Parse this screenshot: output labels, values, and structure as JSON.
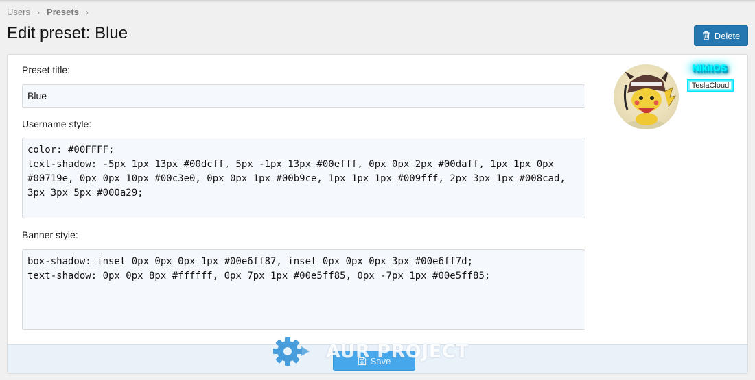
{
  "breadcrumb": {
    "items": [
      "Users",
      "Presets"
    ],
    "separator": "›"
  },
  "page": {
    "title": "Edit preset: Blue"
  },
  "actions": {
    "delete_label": "Delete",
    "save_label": "Save"
  },
  "form": {
    "preset_title_label": "Preset title:",
    "preset_title_value": "Blue",
    "username_style_label": "Username style:",
    "username_style_value": "color: #00FFFF;\ntext-shadow: -5px 1px 13px #00dcff, 5px -1px 13px #00efff, 0px 0px 2px #00daff, 1px 1px 0px #00719e, 0px 0px 10px #00c3e0, 0px 0px 1px #00b9ce, 1px 1px 1px #009fff, 2px 3px 1px #008cad, 3px 3px 5px #000a29;",
    "banner_style_label": "Banner style:",
    "banner_style_value": "box-shadow: inset 0px 0px 0px 1px #00e6ff87, inset 0px 0px 0px 3px #00e6ff7d;\ntext-shadow: 0px 0px 8px #ffffff, 0px 7px 1px #00e5ff85, 0px -7px 1px #00e5ff85;"
  },
  "preview": {
    "username": "NikitOS",
    "banner": "TeslaCloud",
    "username_color": "#00FFFF"
  },
  "watermark": {
    "text": "AUR PROJECT"
  },
  "colors": {
    "primary_button": "#2577b1",
    "save_button": "#47a7eb",
    "footer_bg": "#e9f1f9"
  },
  "icons": {
    "delete": "trash-icon",
    "save": "save-icon",
    "separator": "chevron-right-icon"
  }
}
